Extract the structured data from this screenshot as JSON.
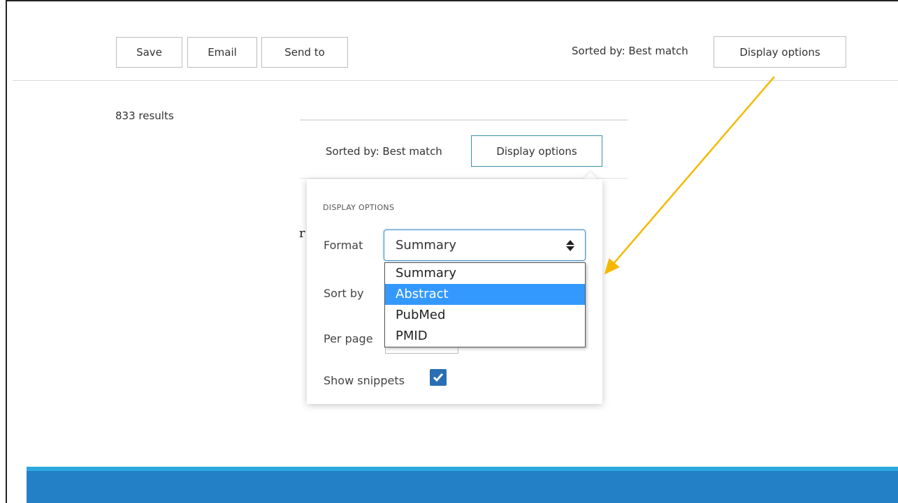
{
  "toolbar": {
    "save_label": "Save",
    "email_label": "Email",
    "send_to_label": "Send to",
    "sorted_by": "Sorted by: Best match",
    "display_options_label": "Display options"
  },
  "results": {
    "count_text": "833 results"
  },
  "inset": {
    "sorted_by": "Sorted by: Best match",
    "display_options_label": "Display options",
    "partial_text": "r"
  },
  "display_panel": {
    "heading": "DISPLAY OPTIONS",
    "format_label": "Format",
    "format_value": "Summary",
    "sort_by_label": "Sort by",
    "per_page_label": "Per page",
    "show_snippets_label": "Show snippets",
    "show_snippets_checked": true,
    "format_options": [
      {
        "label": "Summary",
        "selected": false
      },
      {
        "label": "Abstract",
        "selected": true
      },
      {
        "label": "PubMed",
        "selected": false
      },
      {
        "label": "PMID",
        "selected": false
      }
    ]
  },
  "colors": {
    "arrow": "#f5b800",
    "footer": "#2380c6",
    "footer_top": "#2ba9e0",
    "selected_option": "#3399ff",
    "checkbox": "#2a6fb3"
  },
  "icons": {
    "arrow": "double-headed-arrow",
    "select_caret": "up-down-caret-icon",
    "checkbox": "checkmark-icon"
  }
}
